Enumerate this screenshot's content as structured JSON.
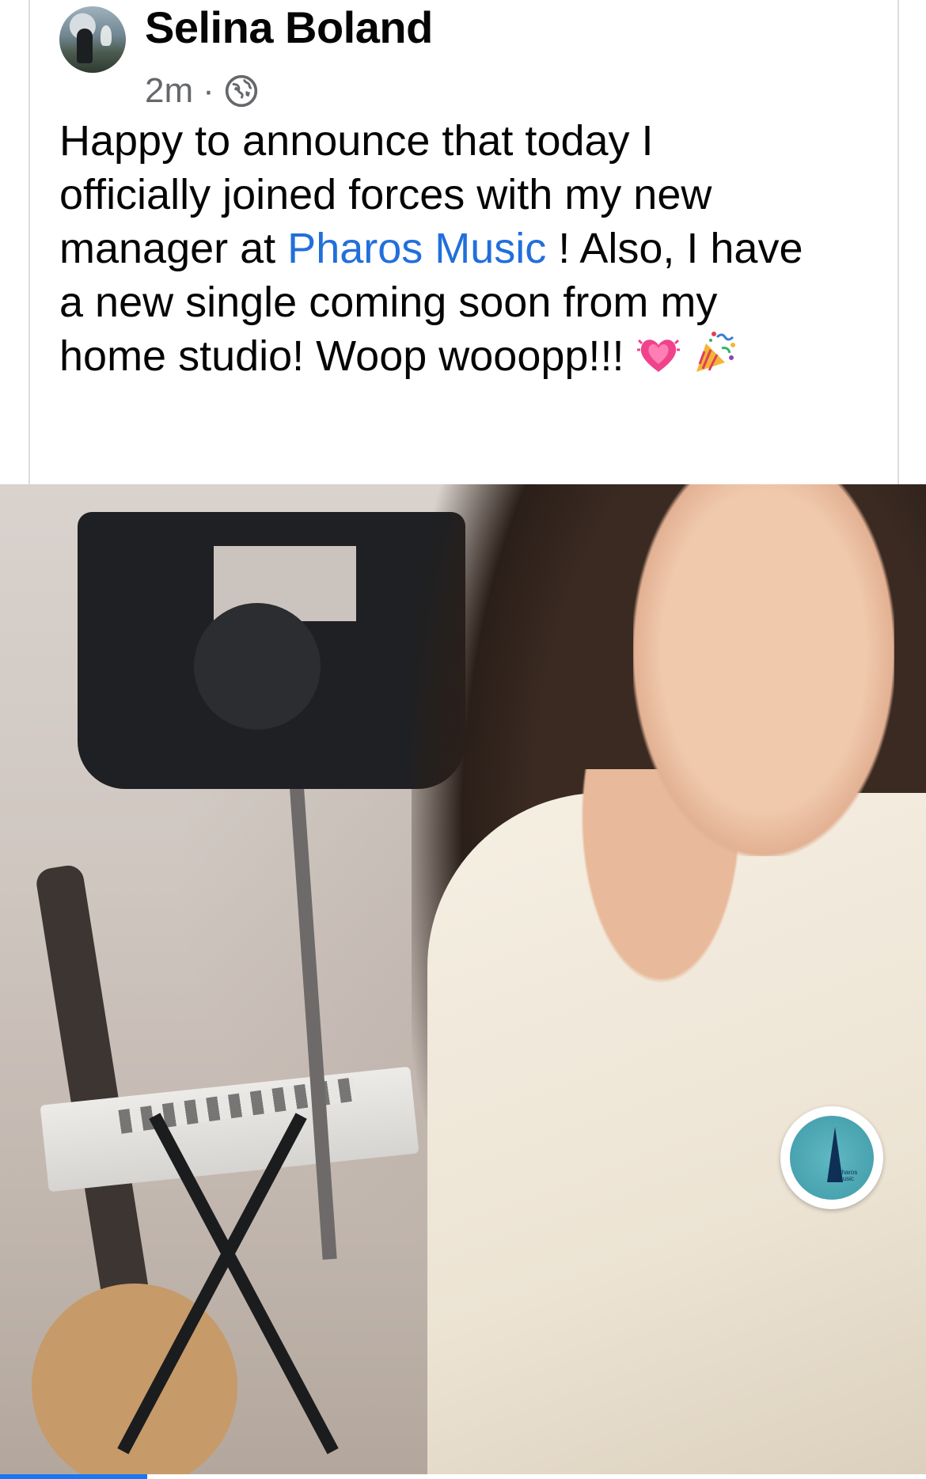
{
  "post": {
    "author": "Selina Boland",
    "time": "2m",
    "separator": "·",
    "audience_icon": "globe-icon",
    "text_lines": [
      "Happy to announce that today I",
      "officially joined forces with my new",
      "manager at ",
      "a new single coming soon from my",
      "home studio! Woop wooopp!!! "
    ],
    "link_text": "Pharos Music",
    "after_link": " ! Also, I have",
    "emojis": [
      "growing-heart-emoji",
      "party-popper-emoji"
    ]
  },
  "photo": {
    "badge_text": "Pharos Music"
  },
  "colors": {
    "link": "#216fdb",
    "meta": "#65676b",
    "progress": "#1877f2"
  }
}
